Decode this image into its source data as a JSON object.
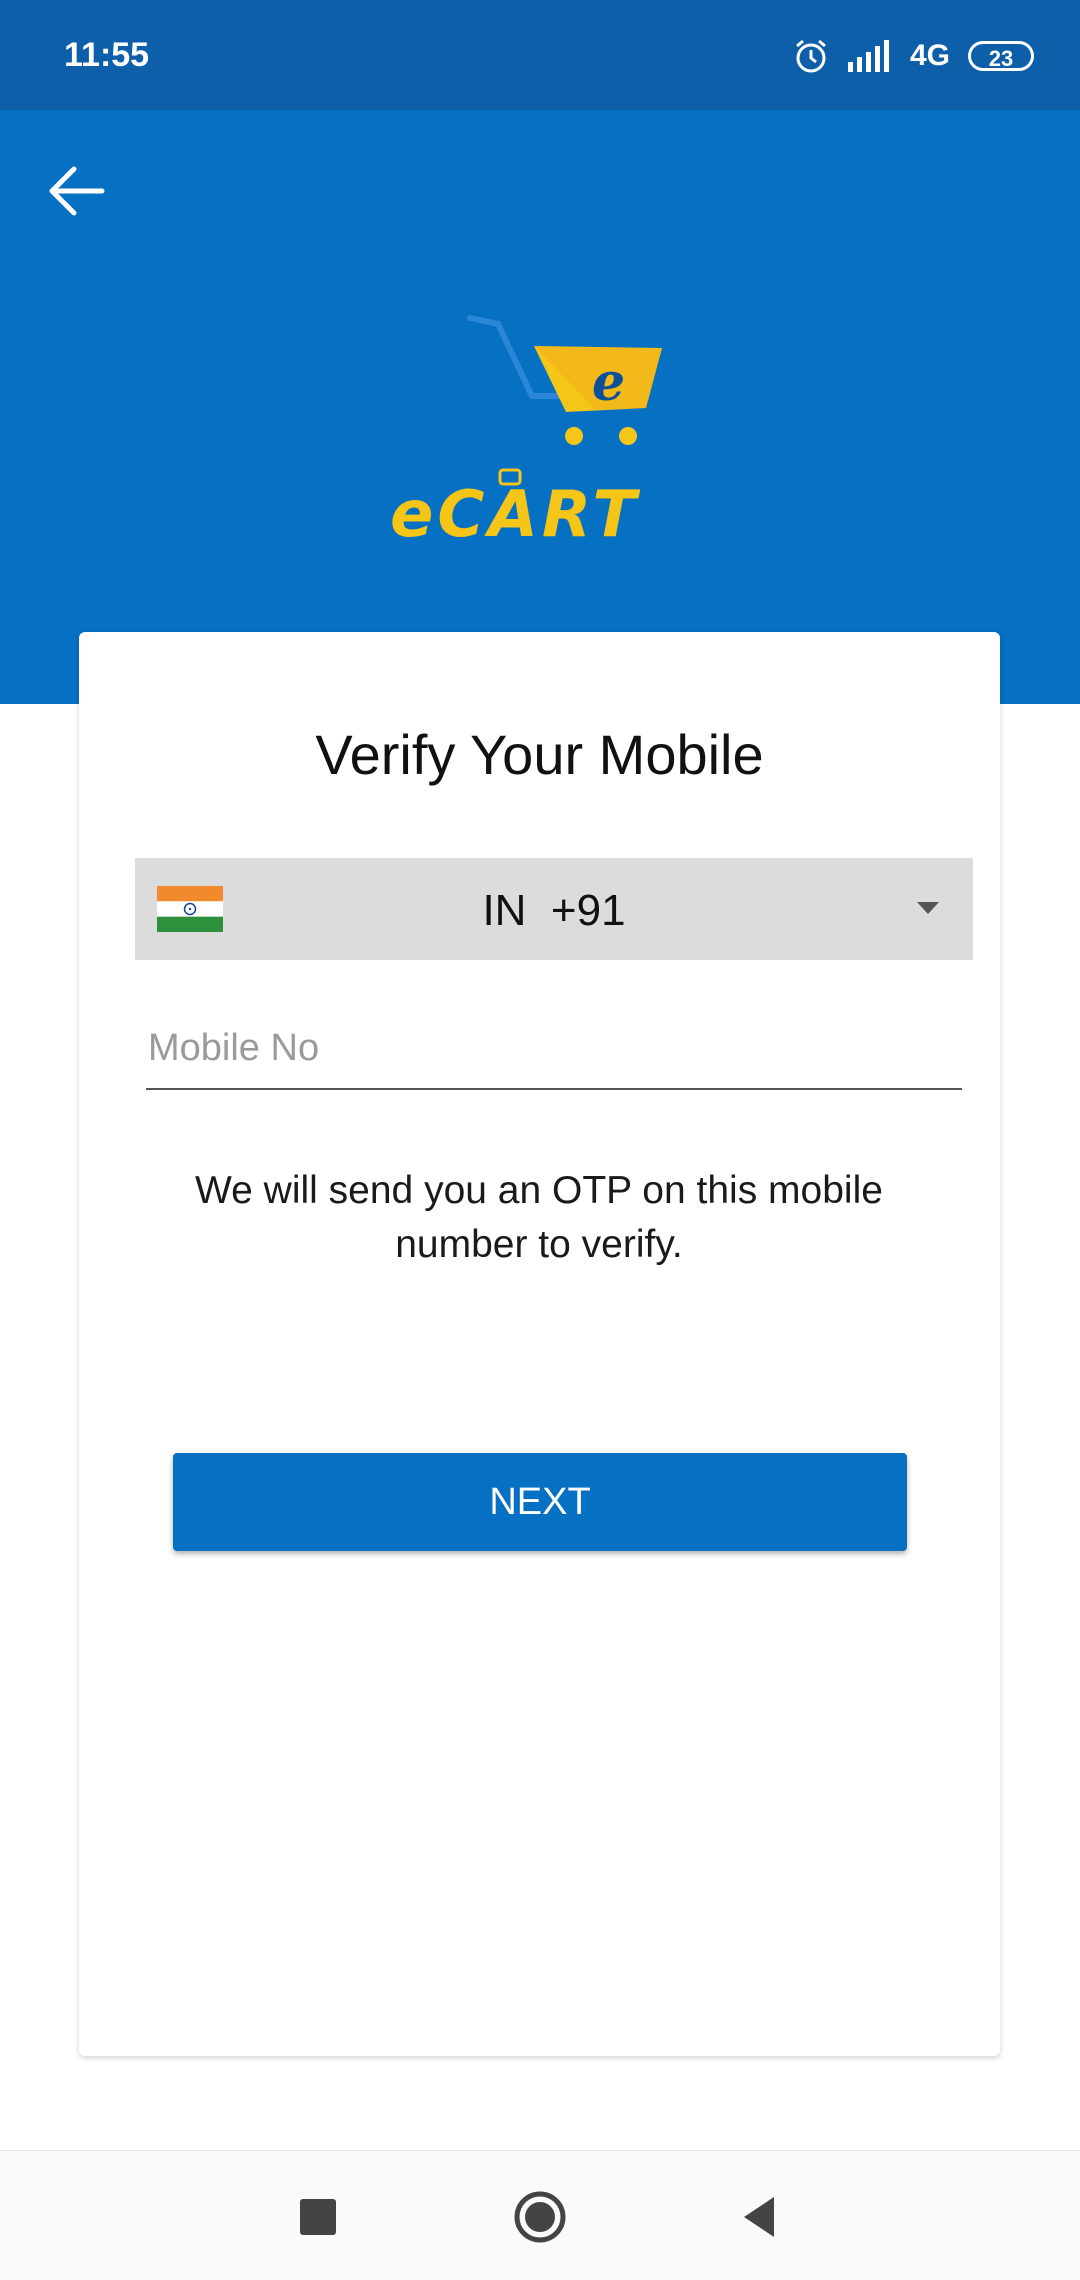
{
  "status_bar": {
    "time": "11:55",
    "network": "4G",
    "battery": "23",
    "icons": [
      "alarm-icon",
      "signal-icon",
      "battery-icon"
    ]
  },
  "header": {
    "back_icon": "arrow-left-icon",
    "logo_text": "eCART",
    "colors": {
      "background": "#0670c2",
      "logo_yellow": "#f5c518"
    }
  },
  "card": {
    "title": "Verify Your Mobile",
    "country": {
      "flag_icon": "india-flag-icon",
      "selected": "IN  +91"
    },
    "mobile_input": {
      "placeholder": "Mobile No",
      "value": ""
    },
    "hint": "We will send you an OTP on this mobile number to verify.",
    "next_label": "NEXT"
  },
  "nav_bar": {
    "icons": [
      "recents-square-icon",
      "home-circle-icon",
      "back-triangle-icon"
    ]
  }
}
